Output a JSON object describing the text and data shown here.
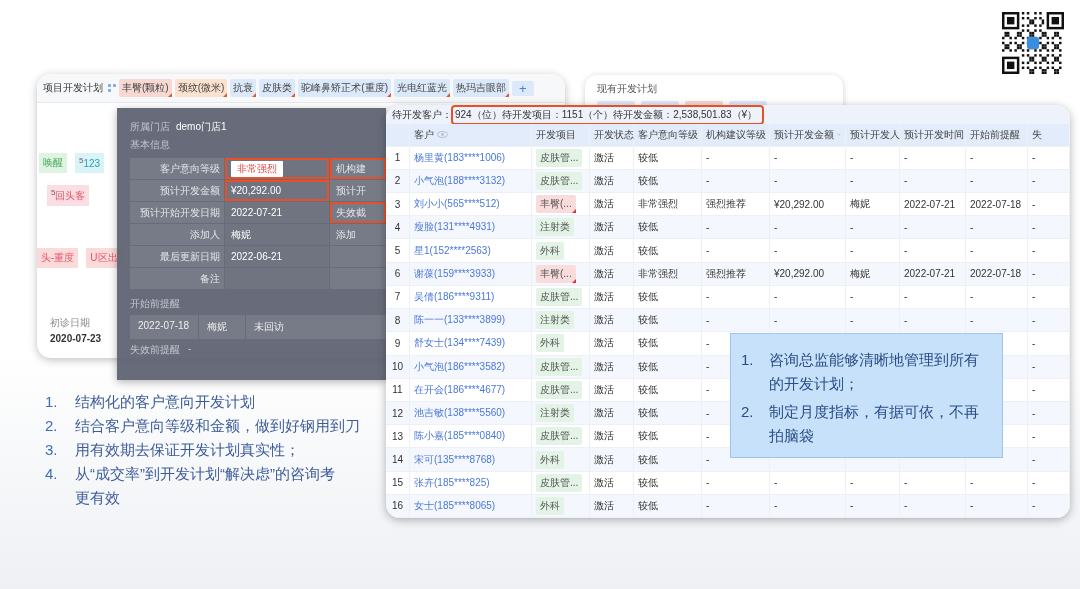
{
  "plan_panel": {
    "title": "项目开发计划",
    "tabs": [
      {
        "label": "丰臀(颗粒)",
        "color": "#f7d8d2"
      },
      {
        "label": "颈纹(微米)",
        "color": "#fbe2d0"
      },
      {
        "label": "抗衰",
        "color": "#dce9fb"
      },
      {
        "label": "皮肤类",
        "color": "#dce9fb"
      },
      {
        "label": "驼峰鼻矫正术(重度)",
        "color": "#dce9fb"
      },
      {
        "label": "光电红蓝光",
        "color": "#dce9fb"
      },
      {
        "label": "热玛吉眼部",
        "color": "#dce9fb"
      }
    ],
    "add_button": "+",
    "tags": [
      {
        "label": "唤醒",
        "color": "#dff3e2"
      },
      {
        "count": "5",
        "label": "123",
        "color": "#d9f3f7"
      },
      {
        "count": "5",
        "label": "回头客",
        "color": "#fbdde4"
      },
      {
        "label": "头-重度",
        "color": "#fbdada"
      },
      {
        "label": "U区出",
        "color": "#fbdada"
      }
    ],
    "first_visit_label": "初诊日期",
    "first_visit": "2020-07-23"
  },
  "detail_popup": {
    "store_label": "所属门店",
    "store": "demo门店1",
    "section": "基本信息",
    "fields": [
      {
        "label": "客户意向等级",
        "kind": "badge",
        "value": "非常强烈",
        "value_highlighted": true,
        "side_label": "机构建",
        "side_highlighted": true
      },
      {
        "label": "预计开发金额",
        "kind": "text",
        "value": "¥20,292.00",
        "value_highlighted": true,
        "side_label": "预计开",
        "side_highlighted": false
      },
      {
        "label": "预计开始开发日期",
        "kind": "text",
        "value": "2022-07-21",
        "value_highlighted": false,
        "side_label": "失效截",
        "side_highlighted": true
      },
      {
        "label": "添加人",
        "kind": "text",
        "value": "梅妮",
        "value_highlighted": false,
        "side_label": "添加",
        "side_highlighted": false
      },
      {
        "label": "最后更新日期",
        "kind": "text",
        "value": "2022-06-21",
        "value_highlighted": false
      },
      {
        "label": "备注",
        "value_highlighted": false
      }
    ],
    "reminder_title": "开始前提醒",
    "reminder": [
      "2022-07-18",
      "梅妮",
      "未回访"
    ],
    "expiry_label": "失效前提醒",
    "expiry_value": "-"
  },
  "current_plans": {
    "title": "现有开发计划",
    "tags": [
      {
        "color": "#dce9fb"
      },
      {
        "color": "#dce9fb"
      },
      {
        "color": "#f7d8d2"
      },
      {
        "color": "#dce9fb"
      }
    ]
  },
  "table": {
    "summary_label": "待开发客户：",
    "summary": "924（位）待开发项目：1151（个）待开发金额：2,538,501.83（¥）",
    "summary_highlighted": true,
    "columns": [
      {},
      {
        "label": "客户"
      },
      {
        "label": "开发项目"
      },
      {
        "label": "开发状态"
      },
      {
        "label": "客户意向等级"
      },
      {
        "label": "机构建议等级"
      },
      {
        "label": "预计开发金额"
      },
      {
        "label": "预计开发人"
      },
      {
        "label": "预计开发时间"
      },
      {
        "label": "开始前提醒"
      },
      {
        "label": "失"
      }
    ],
    "rows": [
      {
        "number": "1",
        "customer": "杨里黄(183****1006)",
        "project": {
          "label": "皮肤管...",
          "color": "#e3f4e6",
          "flagged": false
        },
        "status": "激活",
        "intent": "较低",
        "suggestion": "-",
        "amount": "-",
        "developer": "-",
        "dev_time": "-",
        "reminder": "-",
        "expiry": "-"
      },
      {
        "number": "2",
        "customer": "小气泡(188****3132)",
        "project": {
          "label": "皮肤管...",
          "color": "#e3f4e6",
          "flagged": false
        },
        "status": "激活",
        "intent": "较低",
        "suggestion": "-",
        "amount": "-",
        "developer": "-",
        "dev_time": "-",
        "reminder": "-",
        "expiry": "-"
      },
      {
        "number": "3",
        "customer": "刘小小(565****512)",
        "project": {
          "label": "丰臀(...",
          "color": "#f9dcdc",
          "flagged": true
        },
        "status": "激活",
        "intent": "非常强烈",
        "suggestion": "强烈推荐",
        "amount": "¥20,292.00",
        "developer": "梅妮",
        "dev_time": "2022-07-21",
        "reminder": "2022-07-18",
        "expiry": "-"
      },
      {
        "number": "4",
        "customer": "瘦脸(131****4931)",
        "project": {
          "label": "注射类",
          "color": "#e3f4e6",
          "flagged": false
        },
        "status": "激活",
        "intent": "较低",
        "suggestion": "-",
        "amount": "-",
        "developer": "-",
        "dev_time": "-",
        "reminder": "-",
        "expiry": "-"
      },
      {
        "number": "5",
        "customer": "星1(152****2563)",
        "project": {
          "label": "外科",
          "color": "#e3f4e6",
          "flagged": false
        },
        "status": "激活",
        "intent": "较低",
        "suggestion": "-",
        "amount": "-",
        "developer": "-",
        "dev_time": "-",
        "reminder": "-",
        "expiry": "-"
      },
      {
        "number": "6",
        "customer": "谢葆(159****3933)",
        "project": {
          "label": "丰臀(...",
          "color": "#f9dcdc",
          "flagged": true
        },
        "status": "激活",
        "intent": "非常强烈",
        "suggestion": "强烈推荐",
        "amount": "¥20,292.00",
        "developer": "梅妮",
        "dev_time": "2022-07-21",
        "reminder": "2022-07-18",
        "expiry": "-"
      },
      {
        "number": "7",
        "customer": "吴倩(186****9311)",
        "project": {
          "label": "皮肤管...",
          "color": "#e3f4e6",
          "flagged": false
        },
        "status": "激活",
        "intent": "较低",
        "suggestion": "-",
        "amount": "-",
        "developer": "-",
        "dev_time": "-",
        "reminder": "-",
        "expiry": "-"
      },
      {
        "number": "8",
        "customer": "陈一一(133****3899)",
        "project": {
          "label": "注射类",
          "color": "#e3f4e6",
          "flagged": false
        },
        "status": "激活",
        "intent": "较低",
        "suggestion": "-",
        "amount": "-",
        "developer": "-",
        "dev_time": "-",
        "reminder": "-",
        "expiry": "-"
      },
      {
        "number": "9",
        "customer": "舒女士(134****7439)",
        "project": {
          "label": "外科",
          "color": "#e3f4e6",
          "flagged": false
        },
        "status": "激活",
        "intent": "较低",
        "suggestion": "-",
        "expiry": "-"
      },
      {
        "number": "10",
        "customer": "小气泡(186****3582)",
        "project": {
          "label": "皮肤管...",
          "color": "#e3f4e6",
          "flagged": false
        },
        "status": "激活",
        "intent": "较低",
        "suggestion": "-",
        "expiry": "-"
      },
      {
        "number": "11",
        "customer": "在开会(186****4677)",
        "project": {
          "label": "皮肤管...",
          "color": "#e3f4e6",
          "flagged": false
        },
        "status": "激活",
        "intent": "较低",
        "suggestion": "-",
        "expiry": "-"
      },
      {
        "number": "12",
        "customer": "池吉敏(138****5560)",
        "project": {
          "label": "注射类",
          "color": "#e3f4e6",
          "flagged": false
        },
        "status": "激活",
        "intent": "较低",
        "suggestion": "-",
        "expiry": "-"
      },
      {
        "number": "13",
        "customer": "陈小嘉(185****0840)",
        "project": {
          "label": "皮肤管...",
          "color": "#e3f4e6",
          "flagged": false
        },
        "status": "激活",
        "intent": "较低",
        "suggestion": "-",
        "expiry": "-"
      },
      {
        "number": "14",
        "customer": "宋可(135****8768)",
        "project": {
          "label": "外科",
          "color": "#e3f4e6",
          "flagged": false
        },
        "status": "激活",
        "intent": "较低",
        "suggestion": "-",
        "expiry": "-"
      },
      {
        "number": "15",
        "customer": "张卉(185****825)",
        "project": {
          "label": "皮肤管...",
          "color": "#e3f4e6",
          "flagged": false
        },
        "status": "激活",
        "intent": "较低",
        "suggestion": "-",
        "amount": "-",
        "developer": "-",
        "dev_time": "-",
        "reminder": "-",
        "expiry": "-"
      },
      {
        "number": "16",
        "customer": "女士(185****8065)",
        "project": {
          "label": "外科",
          "color": "#e3f4e6",
          "flagged": false
        },
        "status": "激活",
        "intent": "较低",
        "suggestion": "-",
        "amount": "-",
        "developer": "-",
        "dev_time": "-",
        "reminder": "-",
        "expiry": "-"
      }
    ]
  },
  "notes": [
    {
      "number": "1.",
      "lines": [
        "结构化的客户意向开发计划"
      ]
    },
    {
      "number": "2.",
      "lines": [
        "结合客户意向等级和金额，做到好钢用到刀"
      ]
    },
    {
      "number": "3.",
      "lines": [
        "用有效期去保证开发计划真实性；"
      ]
    },
    {
      "number": "4.",
      "lines": [
        "从“成交率”到开发计划“解决虑”的咨询考",
        "更有效"
      ]
    }
  ],
  "callout": [
    {
      "number": "1.",
      "text": "咨询总监能够清晰地管理到所有的开发计划；"
    },
    {
      "number": "2.",
      "text": "制定月度指标，有据可依，不再拍脑袋"
    }
  ]
}
